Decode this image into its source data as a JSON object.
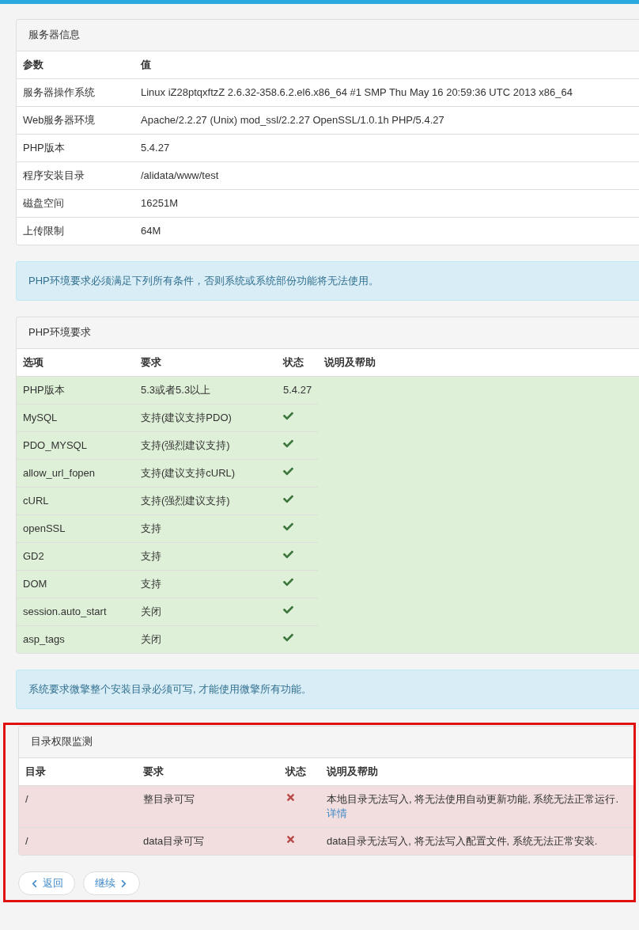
{
  "server_panel": {
    "title": "服务器信息",
    "columns": [
      "参数",
      "值"
    ],
    "rows": [
      {
        "param": "服务器操作系统",
        "value": "Linux iZ28ptqxftzZ 2.6.32-358.6.2.el6.x86_64 #1 SMP Thu May 16 20:59:36 UTC 2013 x86_64"
      },
      {
        "param": "Web服务器环境",
        "value": "Apache/2.2.27 (Unix) mod_ssl/2.2.27 OpenSSL/1.0.1h PHP/5.4.27"
      },
      {
        "param": "PHP版本",
        "value": "5.4.27"
      },
      {
        "param": "程序安装目录",
        "value": "/alidata/www/test"
      },
      {
        "param": "磁盘空间",
        "value": "16251M"
      },
      {
        "param": "上传限制",
        "value": "64M"
      }
    ]
  },
  "php_notice": "PHP环境要求必须满足下列所有条件，否则系统或系统部份功能将无法使用。",
  "php_panel": {
    "title": "PHP环境要求",
    "columns": [
      "选项",
      "要求",
      "状态",
      "说明及帮助"
    ],
    "rows": [
      {
        "option": "PHP版本",
        "requirement": "5.3或者5.3以上",
        "passed": true,
        "reading": "5.4.27"
      },
      {
        "option": "MySQL",
        "requirement": "支持(建议支持PDO)",
        "passed": true
      },
      {
        "option": "PDO_MYSQL",
        "requirement": "支持(强烈建议支持)",
        "passed": true
      },
      {
        "option": "allow_url_fopen",
        "requirement": "支持(建议支持cURL)",
        "passed": true
      },
      {
        "option": "cURL",
        "requirement": "支持(强烈建议支持)",
        "passed": true
      },
      {
        "option": "openSSL",
        "requirement": "支持",
        "passed": true
      },
      {
        "option": "GD2",
        "requirement": "支持",
        "passed": true
      },
      {
        "option": "DOM",
        "requirement": "支持",
        "passed": true
      },
      {
        "option": "session.auto_start",
        "requirement": "关闭",
        "passed": true
      },
      {
        "option": "asp_tags",
        "requirement": "关闭",
        "passed": true
      }
    ]
  },
  "dir_notice": "系统要求微擎整个安装目录必须可写, 才能使用微擎所有功能。",
  "dir_section": {
    "highlighted": true,
    "panel": {
      "title": "目录权限监测",
      "columns": [
        "目录",
        "要求",
        "状态",
        "说明及帮助"
      ],
      "rows": [
        {
          "directory": "/",
          "requirement": "整目录可写",
          "passed": false,
          "help": "本地目录无法写入, 将无法使用自动更新功能, 系统无法正常运行.",
          "link": "详情"
        },
        {
          "directory": "/",
          "requirement": "data目录可写",
          "passed": false,
          "help": "data目录无法写入, 将无法写入配置文件, 系统无法正常安装."
        }
      ]
    },
    "buttons": [
      {
        "label": "返回",
        "kind": "back"
      },
      {
        "label": "继续",
        "kind": "next"
      }
    ]
  }
}
